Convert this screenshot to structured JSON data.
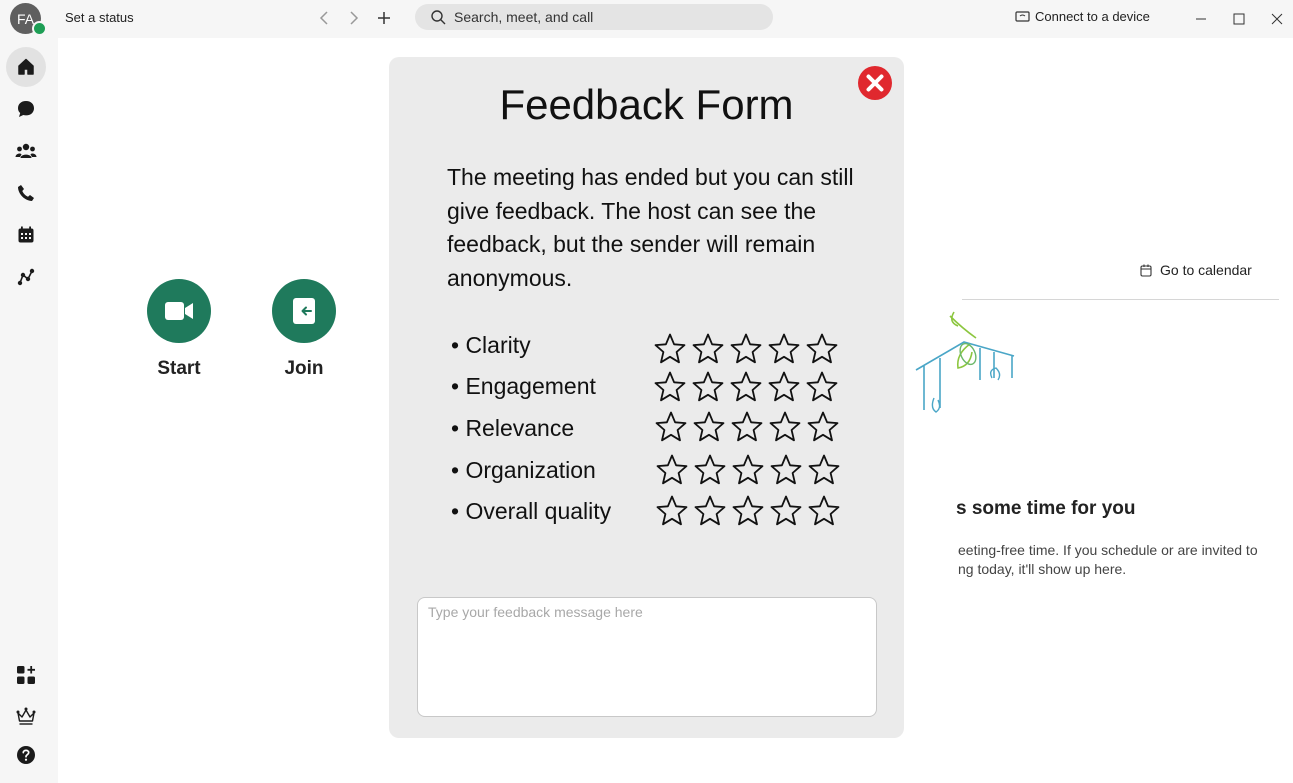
{
  "titlebar": {
    "avatar_initials": "FA",
    "status_label": "Set a status",
    "search_placeholder": "Search, meet, and call",
    "connect_label": "Connect to a device"
  },
  "sidebar": {
    "items": [
      {
        "icon": "home-icon",
        "active": true
      },
      {
        "icon": "chat-icon"
      },
      {
        "icon": "teams-icon"
      },
      {
        "icon": "phone-icon"
      },
      {
        "icon": "calendar-icon"
      },
      {
        "icon": "workflow-icon"
      }
    ],
    "bottom_items": [
      {
        "icon": "apps-add-icon"
      },
      {
        "icon": "crown-icon"
      },
      {
        "icon": "help-icon"
      }
    ]
  },
  "main": {
    "start_label": "Start",
    "join_label": "Join",
    "go_to_calendar": "Go to calendar",
    "empty_title": "s some time for you",
    "empty_desc_line1": "eeting-free time. If you schedule or are invited to",
    "empty_desc_line2": "ng today, it'll show up here."
  },
  "feedback": {
    "title": "Feedback Form",
    "description": "The meeting has ended but you can still give feedback. The host can see the feedback, but the sender will remain anonymous.",
    "criteria": [
      {
        "label": "• Clarity",
        "rating": 0
      },
      {
        "label": "• Engagement",
        "rating": 0
      },
      {
        "label": "• Relevance",
        "rating": 0
      },
      {
        "label": "• Organization",
        "rating": 0
      },
      {
        "label": "• Overall quality",
        "rating": 0
      }
    ],
    "max_rating": 5,
    "message_placeholder": "Type your feedback message here",
    "message_value": ""
  },
  "colors": {
    "accent": "#1f7a5c",
    "close": "#e0282e",
    "presence": "#1e9e55"
  }
}
